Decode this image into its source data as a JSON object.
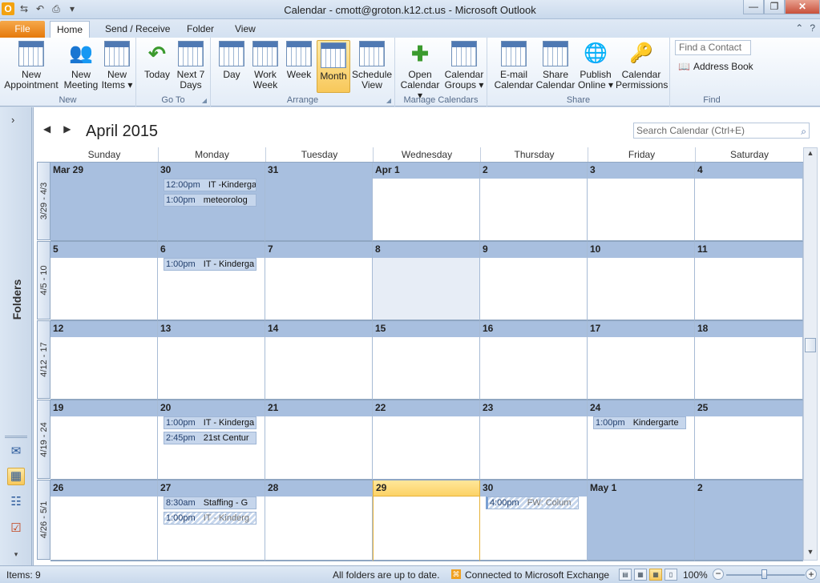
{
  "window": {
    "title": "Calendar - cmott@groton.k12.ct.us  -  Microsoft Outlook",
    "minimize": "—",
    "restore": "❐",
    "close": "✕"
  },
  "quick_access": [
    {
      "name": "outlook-logo-icon",
      "glyph": "O"
    },
    {
      "name": "send-receive-icon",
      "glyph": "⇆"
    },
    {
      "name": "undo-icon",
      "glyph": "↶"
    },
    {
      "name": "print-icon",
      "glyph": "⎙"
    },
    {
      "name": "customize-icon",
      "glyph": "▾"
    }
  ],
  "tabs": {
    "file": "File",
    "home": "Home",
    "send_receive": "Send / Receive",
    "folder": "Folder",
    "view": "View",
    "collapse": "⌃",
    "help": "?"
  },
  "ribbon": {
    "new_appointment": "New Appointment",
    "new_meeting": "New Meeting",
    "new_items": "New Items ▾",
    "new_group": "New",
    "today": "Today",
    "next7": "Next 7 Days",
    "goto_group": "Go To",
    "day": "Day",
    "work_week": "Work Week",
    "week": "Week",
    "month": "Month",
    "schedule_view": "Schedule View",
    "arrange_group": "Arrange",
    "open_calendar": "Open Calendar ▾",
    "calendar_groups": "Calendar Groups ▾",
    "manage_group": "Manage Calendars",
    "email_calendar": "E-mail Calendar",
    "share_calendar": "Share Calendar",
    "publish_online": "Publish Online ▾",
    "calendar_permissions": "Calendar Permissions",
    "share_group": "Share",
    "find_contact": "Find a Contact",
    "address_book": "Address Book",
    "find_group": "Find"
  },
  "nav": {
    "expand": "›",
    "folders": "Folders"
  },
  "calendar": {
    "prev": "◀",
    "next": "▶",
    "title": "April 2015",
    "search_placeholder": "Search Calendar (Ctrl+E)",
    "day_names": [
      "Sunday",
      "Monday",
      "Tuesday",
      "Wednesday",
      "Thursday",
      "Friday",
      "Saturday"
    ],
    "week_labels": [
      "3/29 - 4/3",
      "4/5 - 10",
      "4/12 - 17",
      "4/19 - 24",
      "4/26 - 5/1"
    ],
    "weeks": [
      [
        "Mar 29",
        "30",
        "31",
        "Apr 1",
        "2",
        "3",
        "4"
      ],
      [
        "5",
        "6",
        "7",
        "8",
        "9",
        "10",
        "11"
      ],
      [
        "12",
        "13",
        "14",
        "15",
        "16",
        "17",
        "18"
      ],
      [
        "19",
        "20",
        "21",
        "22",
        "23",
        "24",
        "25"
      ],
      [
        "26",
        "27",
        "28",
        "29",
        "30",
        "May 1",
        "2"
      ]
    ],
    "appointments": [
      {
        "week": 0,
        "day": 1,
        "slot": 0,
        "time": "12:00pm",
        "subject": "IT -Kinderga",
        "style": "normal"
      },
      {
        "week": 0,
        "day": 1,
        "slot": 1,
        "time": "1:00pm",
        "subject": "meteorolog",
        "style": "normal"
      },
      {
        "week": 1,
        "day": 1,
        "slot": 0,
        "time": "1:00pm",
        "subject": "IT - Kinderga",
        "style": "normal"
      },
      {
        "week": 3,
        "day": 1,
        "slot": 0,
        "time": "1:00pm",
        "subject": "IT - Kinderga",
        "style": "normal"
      },
      {
        "week": 3,
        "day": 1,
        "slot": 1,
        "time": "2:45pm",
        "subject": "21st Centur",
        "style": "normal"
      },
      {
        "week": 3,
        "day": 5,
        "slot": 0,
        "time": "1:00pm",
        "subject": "Kindergarte",
        "style": "normal"
      },
      {
        "week": 4,
        "day": 1,
        "slot": 0,
        "time": "8:30am",
        "subject": "Staffing - G",
        "style": "normal"
      },
      {
        "week": 4,
        "day": 1,
        "slot": 1,
        "time": "1:00pm",
        "subject": "IT - Kinderg",
        "style": "tentative"
      },
      {
        "week": 4,
        "day": 4,
        "slot": 0,
        "time": "4:00pm",
        "subject": "FW: Colum",
        "style": "stripe"
      }
    ]
  },
  "status": {
    "items": "Items: 9",
    "up_to_date": "All folders are up to date.",
    "exchange": "Connected to Microsoft Exchange",
    "zoom": "100%",
    "minus": "−",
    "plus": "+"
  }
}
